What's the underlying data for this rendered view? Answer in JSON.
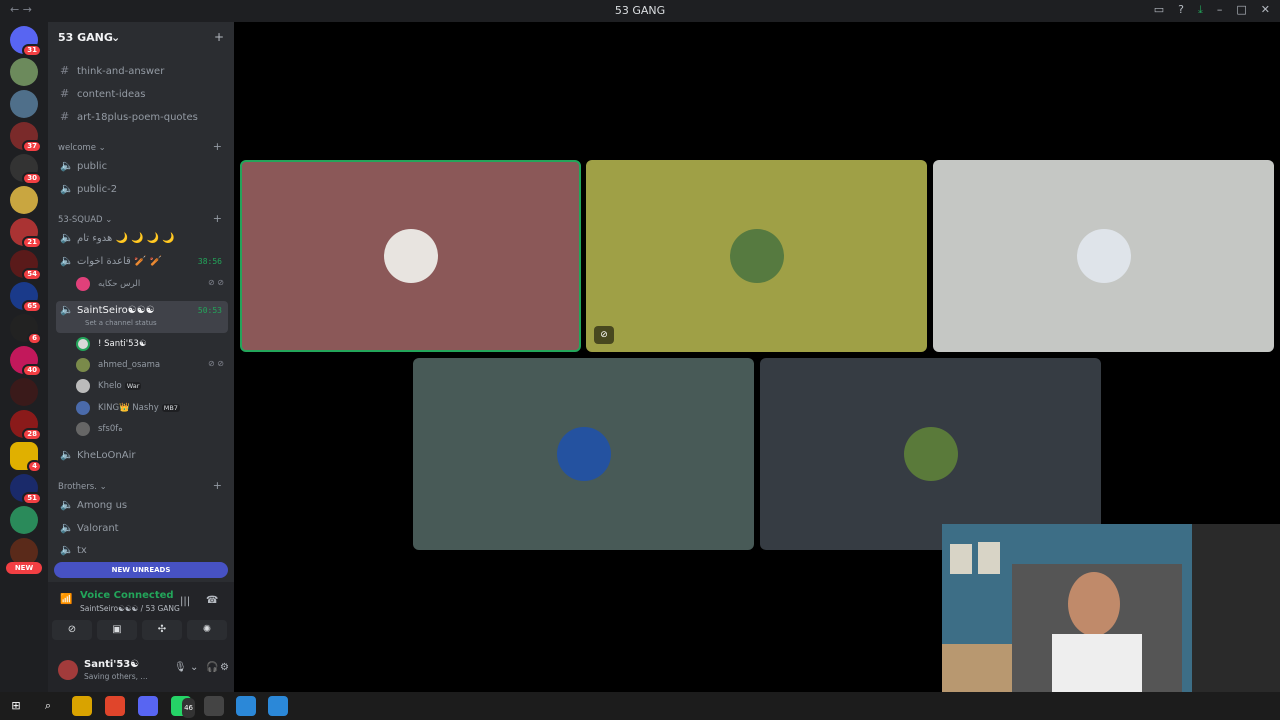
{
  "window": {
    "title": "53 GANG"
  },
  "server": {
    "name": "53 GANG"
  },
  "channels_top": [
    {
      "name": "think-and-answer"
    },
    {
      "name": "content-ideas"
    },
    {
      "name": "art-18plus-poem-quotes"
    }
  ],
  "categories": {
    "welcome": "welcome",
    "squad": "53-SQUAD",
    "brothers": "Brothers."
  },
  "welcome_channels": [
    {
      "name": "public"
    },
    {
      "name": "public-2"
    }
  ],
  "squad_channels": {
    "c1": "هدوء تام 🌙 🌙 🌙 🌙",
    "c2": "قاعدة اخوات 🏏 🏏",
    "c2_timer": "38:56",
    "c2_member": "الرس حكايه",
    "active": "SaintSeiro☯☯☯",
    "active_timer": "50:53",
    "active_status": "Set a channel status",
    "members": [
      {
        "name": "! Santi'53☯",
        "tag": ""
      },
      {
        "name": "ahmed_osama",
        "tag": ""
      },
      {
        "name": "Khelo",
        "tag": "War"
      },
      {
        "name": "KING👑 Nashy",
        "tag": "MB7"
      },
      {
        "name": "sfs0fه",
        "tag": ""
      }
    ],
    "after": "KheLoOnAir"
  },
  "brothers_channels": [
    {
      "name": "Among us"
    },
    {
      "name": "Valorant"
    },
    {
      "name": "tx"
    }
  ],
  "unreads_label": "NEW UNREADS",
  "guild_badges": [
    "31",
    "37",
    "30",
    "21",
    "54",
    "65",
    "6",
    "40",
    "28",
    "4",
    "51"
  ],
  "new_label": "NEW",
  "voice": {
    "title": "Voice Connected",
    "subtitle": "SaintSeiro☯☯☯ / 53 GANG"
  },
  "user": {
    "name": "Santi'53☯",
    "status": "Saving others, ..."
  },
  "taskbar": {
    "whatsapp_badge": "46"
  },
  "colors": {
    "tile_1": "#8b5858",
    "tile_2": "#9fa046",
    "tile_3": "#c5c7c4",
    "tile_4": "#485a57",
    "tile_5": "#363c43",
    "speaking": "#23a55a"
  }
}
